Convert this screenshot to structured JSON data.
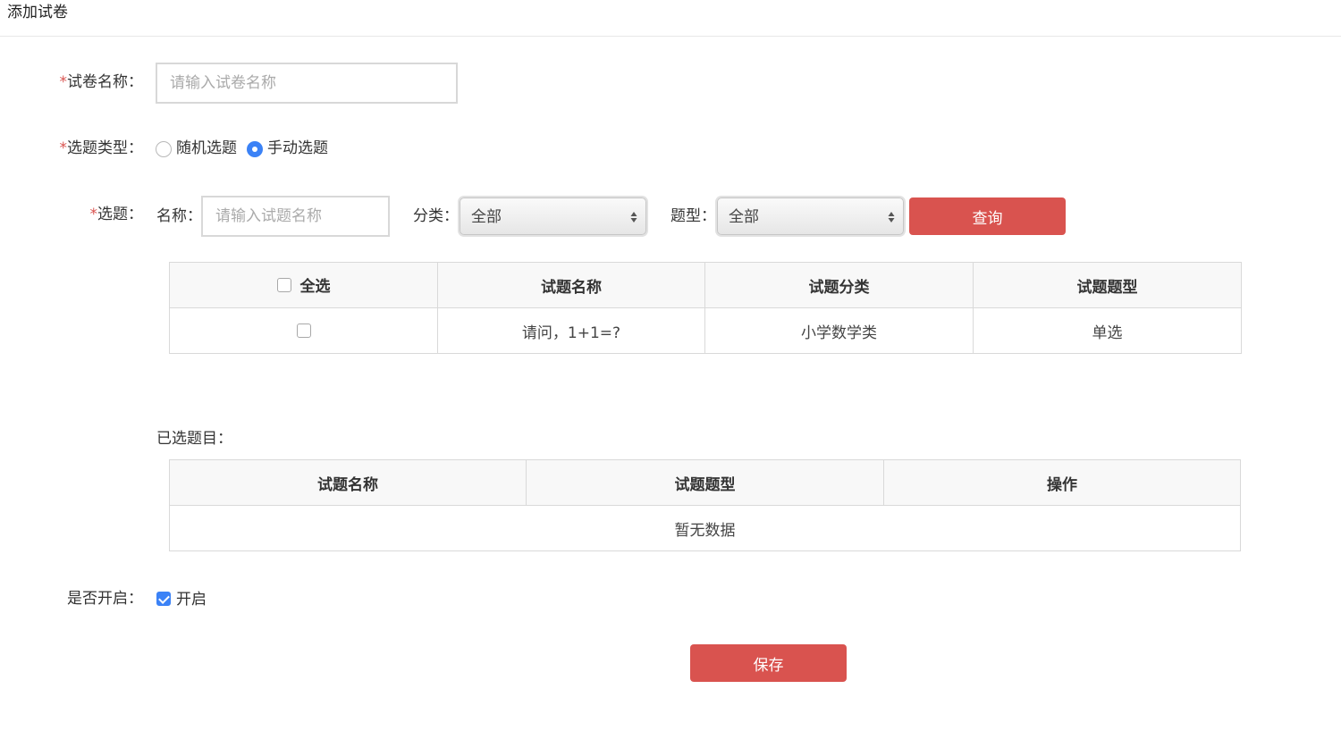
{
  "header": {
    "title": "添加试卷"
  },
  "form": {
    "required_mark": "*",
    "paper_name": {
      "label": "试卷名称：",
      "placeholder": "请输入试卷名称",
      "value": ""
    },
    "select_type": {
      "label": "选题类型：",
      "options": [
        {
          "label": "随机选题",
          "checked": false
        },
        {
          "label": "手动选题",
          "checked": true
        }
      ]
    },
    "question_filter": {
      "label": "选题：",
      "name_label": "名称：",
      "name_placeholder": "请输入试题名称",
      "category_label": "分类：",
      "category_value": "全部",
      "qtype_label": "题型：",
      "qtype_value": "全部",
      "query_button": "查询"
    },
    "question_table": {
      "select_all": "全选",
      "columns": [
        "试题名称",
        "试题分类",
        "试题题型"
      ],
      "rows": [
        {
          "name": "请问，1+1=?",
          "category": "小学数学类",
          "type": "单选",
          "checked": false
        }
      ]
    },
    "selected": {
      "label": "已选题目：",
      "columns": [
        "试题名称",
        "试题题型",
        "操作"
      ],
      "empty_text": "暂无数据"
    },
    "enabled": {
      "label": "是否开启：",
      "option_label": "开启",
      "checked": true
    },
    "save_button": "保存"
  },
  "colors": {
    "accent_red": "#d9534f",
    "accent_blue": "#3b82f6",
    "required": "#d9534f"
  }
}
